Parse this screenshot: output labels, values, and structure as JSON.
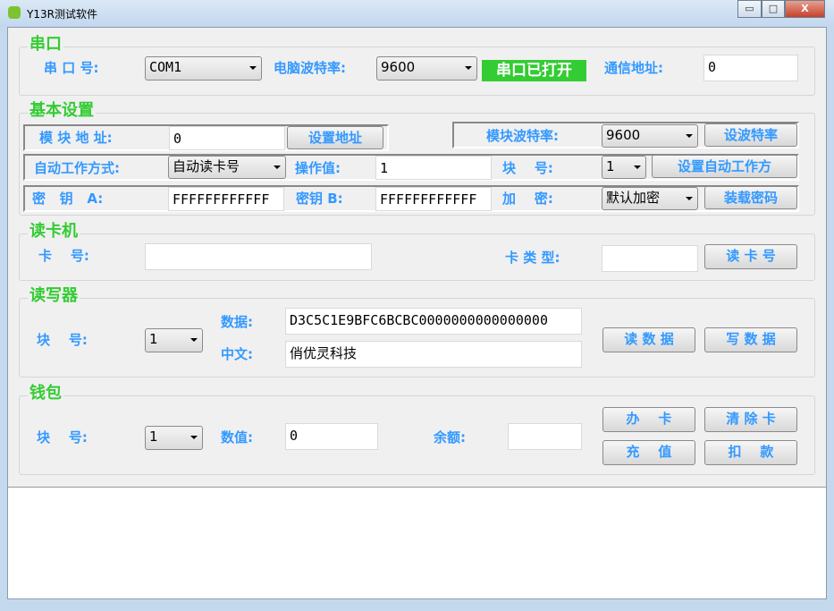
{
  "window": {
    "title": "Y13R测试软件",
    "minimize": "▭",
    "maximize": "□",
    "close": "X"
  },
  "serial": {
    "title": "串口",
    "port_label": "串 口 号:",
    "port_value": "COM1",
    "pc_baud_label": "电脑波特率:",
    "pc_baud_value": "9600",
    "status": "串口已打开",
    "comm_addr_label": "通信地址:",
    "comm_addr_value": "0"
  },
  "basic": {
    "title": "基本设置",
    "module_addr_label": "模 块 地 址:",
    "module_addr_value": "0",
    "set_addr_button": "设置地址",
    "module_baud_label": "模块波特率:",
    "module_baud_value": "9600",
    "set_baud_button": "设波特率",
    "auto_mode_label": "自动工作方式:",
    "auto_mode_value": "自动读卡号",
    "op_value_label": "操作值:",
    "op_value": "1",
    "block_label": "块    号:",
    "block_value": "1",
    "set_auto_button": "设置自动工作方",
    "key_a_label": "密   钥   A:",
    "key_a_value": "FFFFFFFFFFFF",
    "key_b_label": "密钥 B:",
    "key_b_value": "FFFFFFFFFFFF",
    "encrypt_label": "加    密:",
    "encrypt_value": "默认加密",
    "load_key_button": "装载密码"
  },
  "reader": {
    "title": "读卡机",
    "card_no_label": "卡    号:",
    "card_no_value": "",
    "card_type_label": "卡 类 型:",
    "card_type_value": "",
    "read_card_button": "读 卡 号"
  },
  "rw": {
    "title": "读写器",
    "block_label": "块    号:",
    "block_value": "1",
    "data_label": "数据:",
    "data_value": "D3C5C1E9BFC6BCBC0000000000000000",
    "chinese_label": "中文:",
    "chinese_value": "俏优灵科技",
    "read_button": "读 数 据",
    "write_button": "写 数 据"
  },
  "wallet": {
    "title": "钱包",
    "block_label": "块    号:",
    "block_value": "1",
    "value_label": "数值:",
    "value_value": "0",
    "balance_label": "余额:",
    "balance_value": "",
    "issue_button": "办    卡",
    "clear_button": "清 除 卡",
    "charge_button": "充    值",
    "deduct_button": "扣    款"
  },
  "log": {
    "text": ""
  }
}
